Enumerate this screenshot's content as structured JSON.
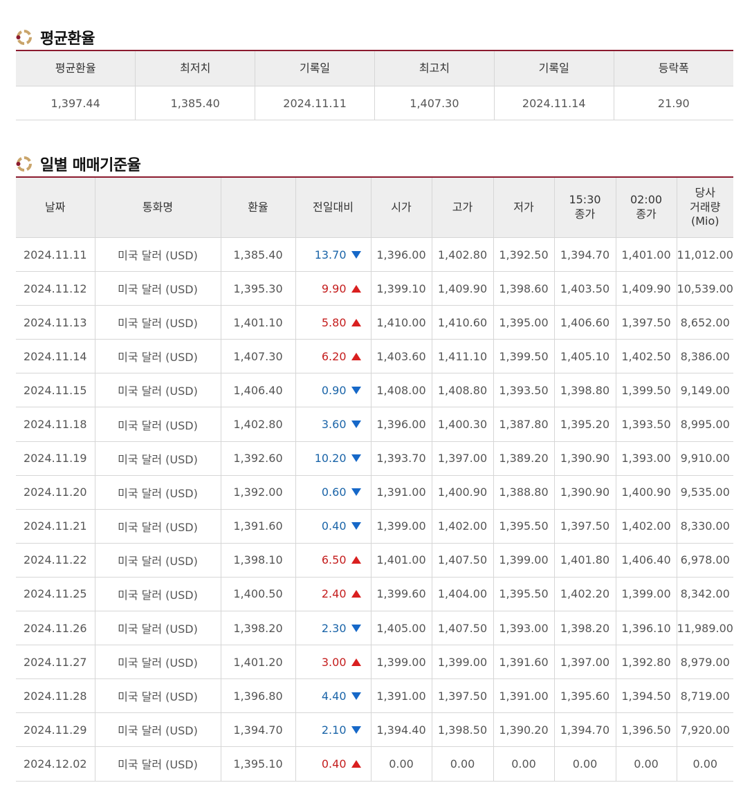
{
  "avg_section": {
    "title": "평균환율",
    "headers": [
      "평균환율",
      "최저치",
      "기록일",
      "최고치",
      "기록일",
      "등락폭"
    ],
    "values": [
      "1,397.44",
      "1,385.40",
      "2024.11.11",
      "1,407.30",
      "2024.11.14",
      "21.90"
    ]
  },
  "daily_section": {
    "title": "일별 매매기준율",
    "headers": {
      "date": "날짜",
      "currency": "통화명",
      "rate": "환율",
      "change": "전일대비",
      "open": "시가",
      "high": "고가",
      "low": "저가",
      "close1530_a": "15:30",
      "close1530_b": "종가",
      "close0200_a": "02:00",
      "close0200_b": "종가",
      "volume_a": "당사",
      "volume_b": "거래량",
      "volume_c": "(Mio)"
    },
    "rows": [
      {
        "date": "2024.11.11",
        "currency": "미국 달러 (USD)",
        "rate": "1,385.40",
        "change": "13.70",
        "dir": "down",
        "open": "1,396.00",
        "high": "1,402.80",
        "low": "1,392.50",
        "c1530": "1,394.70",
        "c0200": "1,401.00",
        "volume": "11,012.00"
      },
      {
        "date": "2024.11.12",
        "currency": "미국 달러 (USD)",
        "rate": "1,395.30",
        "change": "9.90",
        "dir": "up",
        "open": "1,399.10",
        "high": "1,409.90",
        "low": "1,398.60",
        "c1530": "1,403.50",
        "c0200": "1,409.90",
        "volume": "10,539.00"
      },
      {
        "date": "2024.11.13",
        "currency": "미국 달러 (USD)",
        "rate": "1,401.10",
        "change": "5.80",
        "dir": "up",
        "open": "1,410.00",
        "high": "1,410.60",
        "low": "1,395.00",
        "c1530": "1,406.60",
        "c0200": "1,397.50",
        "volume": "8,652.00"
      },
      {
        "date": "2024.11.14",
        "currency": "미국 달러 (USD)",
        "rate": "1,407.30",
        "change": "6.20",
        "dir": "up",
        "open": "1,403.60",
        "high": "1,411.10",
        "low": "1,399.50",
        "c1530": "1,405.10",
        "c0200": "1,402.50",
        "volume": "8,386.00"
      },
      {
        "date": "2024.11.15",
        "currency": "미국 달러 (USD)",
        "rate": "1,406.40",
        "change": "0.90",
        "dir": "down",
        "open": "1,408.00",
        "high": "1,408.80",
        "low": "1,393.50",
        "c1530": "1,398.80",
        "c0200": "1,399.50",
        "volume": "9,149.00"
      },
      {
        "date": "2024.11.18",
        "currency": "미국 달러 (USD)",
        "rate": "1,402.80",
        "change": "3.60",
        "dir": "down",
        "open": "1,396.00",
        "high": "1,400.30",
        "low": "1,387.80",
        "c1530": "1,395.20",
        "c0200": "1,393.50",
        "volume": "8,995.00"
      },
      {
        "date": "2024.11.19",
        "currency": "미국 달러 (USD)",
        "rate": "1,392.60",
        "change": "10.20",
        "dir": "down",
        "open": "1,393.70",
        "high": "1,397.00",
        "low": "1,389.20",
        "c1530": "1,390.90",
        "c0200": "1,393.00",
        "volume": "9,910.00"
      },
      {
        "date": "2024.11.20",
        "currency": "미국 달러 (USD)",
        "rate": "1,392.00",
        "change": "0.60",
        "dir": "down",
        "open": "1,391.00",
        "high": "1,400.90",
        "low": "1,388.80",
        "c1530": "1,390.90",
        "c0200": "1,400.90",
        "volume": "9,535.00"
      },
      {
        "date": "2024.11.21",
        "currency": "미국 달러 (USD)",
        "rate": "1,391.60",
        "change": "0.40",
        "dir": "down",
        "open": "1,399.00",
        "high": "1,402.00",
        "low": "1,395.50",
        "c1530": "1,397.50",
        "c0200": "1,402.00",
        "volume": "8,330.00"
      },
      {
        "date": "2024.11.22",
        "currency": "미국 달러 (USD)",
        "rate": "1,398.10",
        "change": "6.50",
        "dir": "up",
        "open": "1,401.00",
        "high": "1,407.50",
        "low": "1,399.00",
        "c1530": "1,401.80",
        "c0200": "1,406.40",
        "volume": "6,978.00"
      },
      {
        "date": "2024.11.25",
        "currency": "미국 달러 (USD)",
        "rate": "1,400.50",
        "change": "2.40",
        "dir": "up",
        "open": "1,399.60",
        "high": "1,404.00",
        "low": "1,395.50",
        "c1530": "1,402.20",
        "c0200": "1,399.00",
        "volume": "8,342.00"
      },
      {
        "date": "2024.11.26",
        "currency": "미국 달러 (USD)",
        "rate": "1,398.20",
        "change": "2.30",
        "dir": "down",
        "open": "1,405.00",
        "high": "1,407.50",
        "low": "1,393.00",
        "c1530": "1,398.20",
        "c0200": "1,396.10",
        "volume": "11,989.00"
      },
      {
        "date": "2024.11.27",
        "currency": "미국 달러 (USD)",
        "rate": "1,401.20",
        "change": "3.00",
        "dir": "up",
        "open": "1,399.00",
        "high": "1,399.00",
        "low": "1,391.60",
        "c1530": "1,397.00",
        "c0200": "1,392.80",
        "volume": "8,979.00"
      },
      {
        "date": "2024.11.28",
        "currency": "미국 달러 (USD)",
        "rate": "1,396.80",
        "change": "4.40",
        "dir": "down",
        "open": "1,391.00",
        "high": "1,397.50",
        "low": "1,391.00",
        "c1530": "1,395.60",
        "c0200": "1,394.50",
        "volume": "8,719.00"
      },
      {
        "date": "2024.11.29",
        "currency": "미국 달러 (USD)",
        "rate": "1,394.70",
        "change": "2.10",
        "dir": "down",
        "open": "1,394.40",
        "high": "1,398.50",
        "low": "1,390.20",
        "c1530": "1,394.70",
        "c0200": "1,396.50",
        "volume": "7,920.00"
      },
      {
        "date": "2024.12.02",
        "currency": "미국 달러 (USD)",
        "rate": "1,395.10",
        "change": "0.40",
        "dir": "up",
        "open": "0.00",
        "high": "0.00",
        "low": "0.00",
        "c1530": "0.00",
        "c0200": "0.00",
        "volume": "0.00"
      }
    ]
  }
}
